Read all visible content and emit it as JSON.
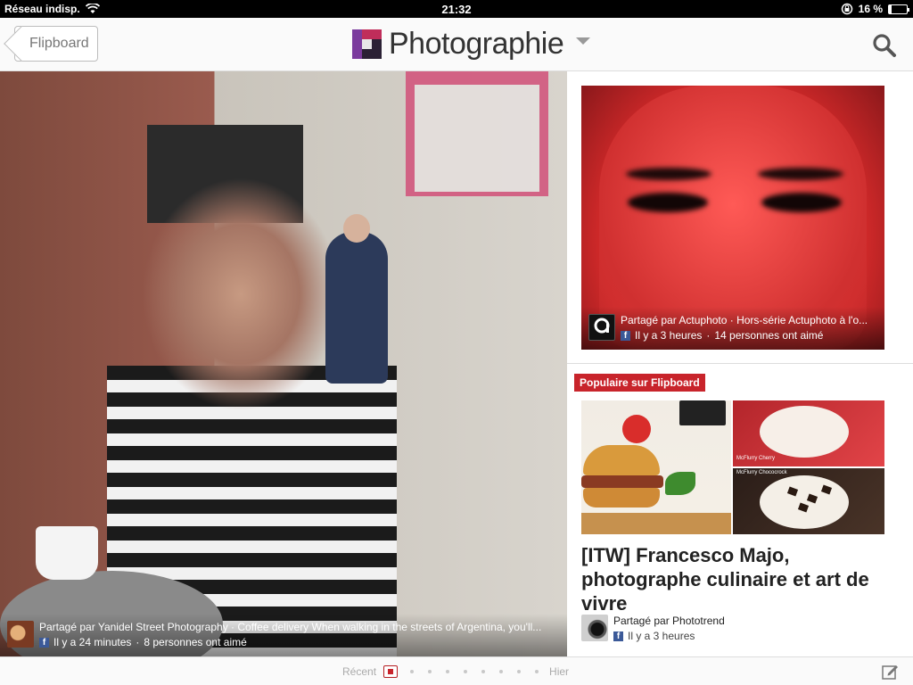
{
  "status_bar": {
    "carrier": "Réseau indisp.",
    "time": "21:32",
    "battery_percent": "16 %",
    "battery_level": 0.16,
    "icons": [
      "wifi-icon",
      "rotation-lock-icon",
      "battery-icon"
    ]
  },
  "header": {
    "back_label": "Flipboard",
    "title": "Photographie",
    "icons": [
      "flipboard-logo-icon",
      "dropdown-caret-icon",
      "search-icon"
    ]
  },
  "main_article": {
    "source_line": "Partagé par Yanidel Street Photography · Coffee delivery  When walking in the streets of Argentina, you'll...",
    "time": "Il y a 24 minutes",
    "likes": "8 personnes ont aimé",
    "separator": "·"
  },
  "side_article_1": {
    "source_line": "Partagé par Actuphoto · Hors-série Actuphoto à l'o...",
    "time": "Il y a 3 heures",
    "likes": "14 personnes ont aimé",
    "separator": "·"
  },
  "popular": {
    "badge": "Populaire sur Flipboard",
    "title": "[ITW] Francesco Majo, photographe culinaire et art de vivre",
    "source": "Partagé par Phototrend",
    "time": "Il y a 3 heures",
    "collage_labels": [
      "McFlurry Cherry",
      "McFlurry Chococrock"
    ]
  },
  "footer": {
    "recent_label": "Récent",
    "older_label": "Hier",
    "page_dots": 8,
    "icons": [
      "compose-icon"
    ]
  },
  "colors": {
    "accent_red": "#c8242b",
    "facebook_blue": "#3b5998",
    "header_bg": "#fafafa"
  }
}
